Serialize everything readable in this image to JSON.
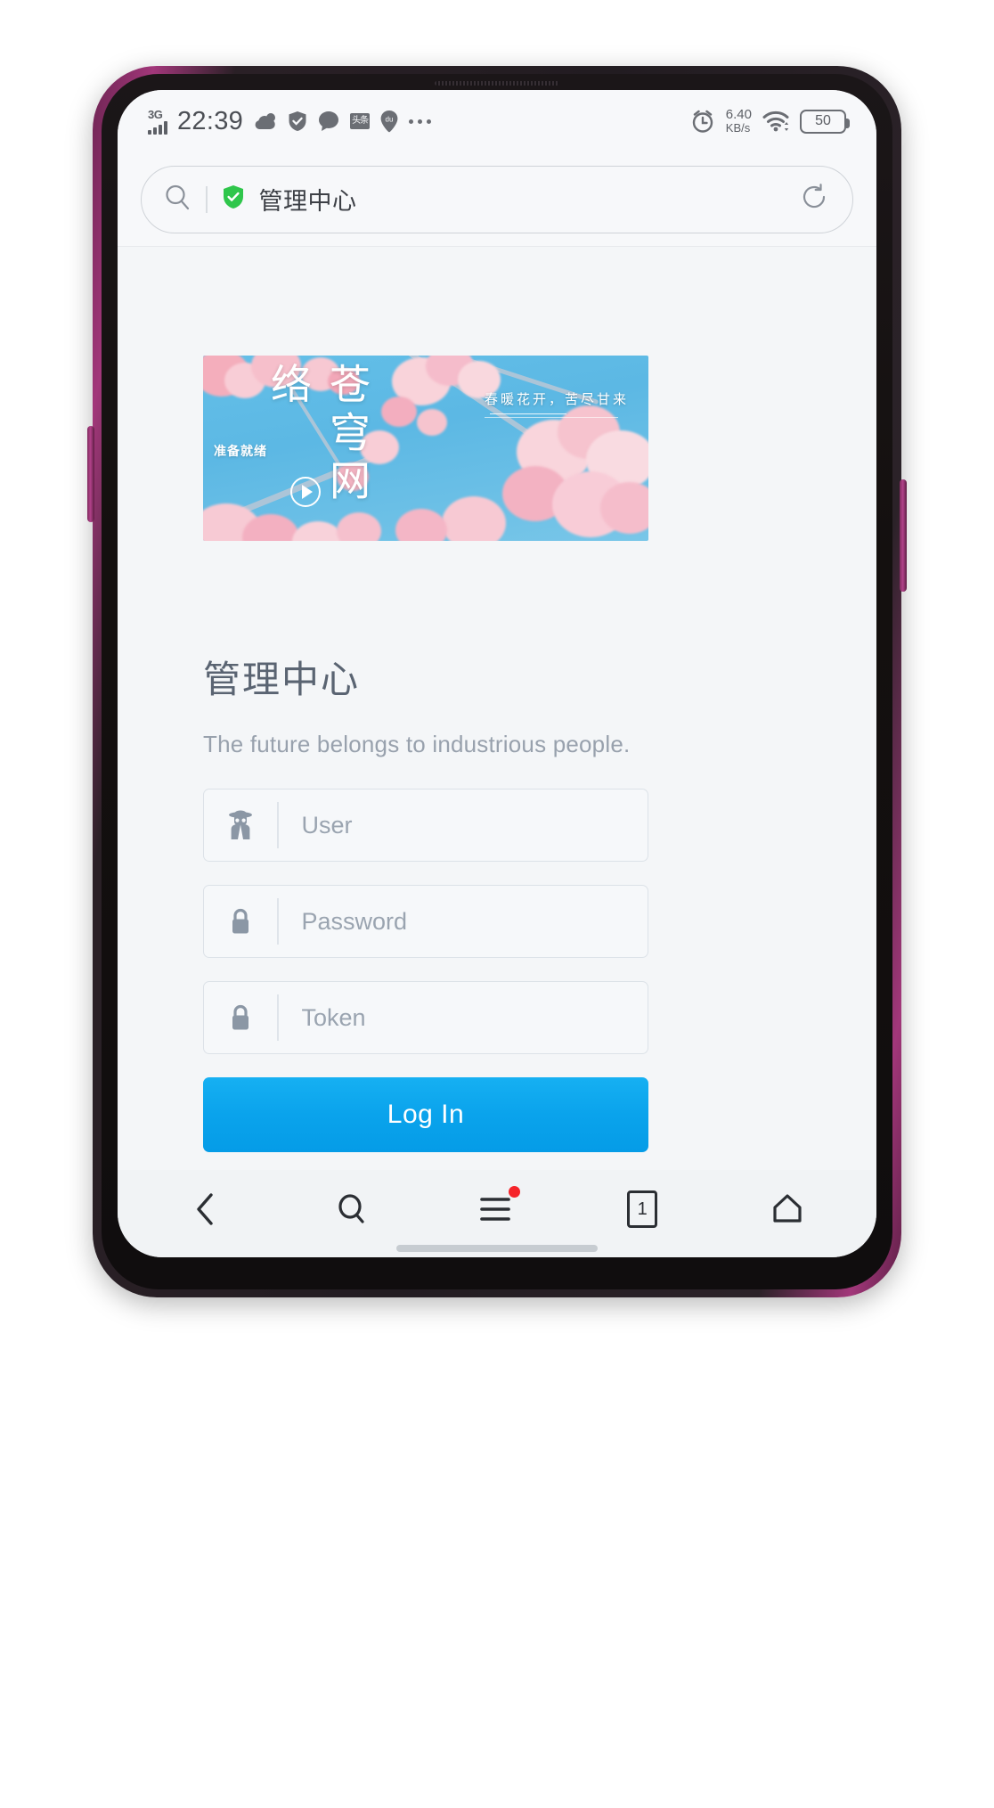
{
  "status_bar": {
    "network_type": "3G",
    "signal_icon": "signal-bars-icon",
    "time": "22:39",
    "icons": [
      {
        "name": "weather-cloud-icon"
      },
      {
        "name": "security-shield-icon"
      },
      {
        "name": "message-bubble-icon"
      },
      {
        "name": "toutiao-app-icon",
        "label": "头条"
      },
      {
        "name": "baidu-location-pin-icon",
        "label": "du"
      },
      {
        "name": "more-icons-ellipsis"
      }
    ],
    "alarm_icon": "alarm-clock-icon",
    "net_speed_value": "6.40",
    "net_speed_unit": "KB/s",
    "wifi_icon": "wifi-icon",
    "battery_level": "50"
  },
  "browser": {
    "search_icon": "search-icon",
    "shield_icon": "verified-shield-icon",
    "page_title": "管理中心",
    "reload_icon": "reload-icon"
  },
  "banner": {
    "vertical_title": "苍穹网络",
    "ready_label": "准备就绪",
    "slogan": "春暖花开，苦尽甘来",
    "play_icon": "play-button-icon"
  },
  "login": {
    "title": "管理中心",
    "subtitle": "The future belongs to industrious people.",
    "fields": [
      {
        "name": "user",
        "icon": "incognito-spy-icon",
        "placeholder": "User",
        "value": ""
      },
      {
        "name": "password",
        "icon": "lock-icon",
        "placeholder": "Password",
        "value": ""
      },
      {
        "name": "token",
        "icon": "lock-icon",
        "placeholder": "Token",
        "value": ""
      }
    ],
    "submit_label": "Log In"
  },
  "bottom_nav": {
    "items": [
      {
        "name": "back",
        "icon": "chevron-left-icon"
      },
      {
        "name": "search",
        "icon": "search-icon"
      },
      {
        "name": "menu",
        "icon": "hamburger-menu-icon",
        "badge": true
      },
      {
        "name": "tabs",
        "icon": "tab-count-icon",
        "label": "1"
      },
      {
        "name": "home",
        "icon": "home-icon"
      }
    ]
  },
  "colors": {
    "accent": "#0aa3ec",
    "shield_green": "#2fc64b",
    "badge_red": "#f5242a",
    "banner_sky": "#5cb8e4"
  }
}
